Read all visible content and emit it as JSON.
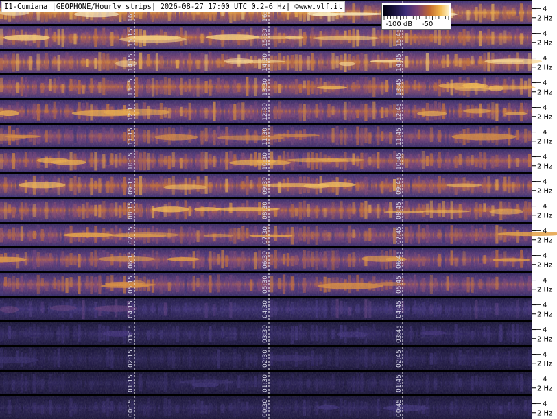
{
  "header": {
    "title": "I1-Cumiana |GEOPHONE/Hourly strips| 2026-08-27 17:00 UTC 0.2-6 Hz| ©www.vlf.it"
  },
  "colorbar": {
    "low_label": "-100 dB",
    "high_label": "-50",
    "stops": [
      "#000010",
      "#1b1442",
      "#3b2d78",
      "#7a3f73",
      "#c2682f",
      "#f2b54a",
      "#fff6d0"
    ]
  },
  "chart_data": {
    "type": "heatmap",
    "title": "I1-Cumiana |GEOPHONE/Hourly strips| 2026-08-27 17:00 UTC 0.2-6 Hz| ©www.vlf.it",
    "colorbar_ticks": [
      "-100 dB",
      "-50"
    ],
    "y_ticks_per_strip": [
      {
        "value": 4,
        "label": "4"
      },
      {
        "value": 2,
        "label": "2 Hz"
      }
    ],
    "strips": [
      {
        "hour": 16,
        "labels": [
          "16:15",
          "16:30",
          ""
        ],
        "intensity": 0.72
      },
      {
        "hour": 15,
        "labels": [
          "15:15",
          "15:30",
          "15:45"
        ],
        "intensity": 0.66
      },
      {
        "hour": 14,
        "labels": [
          "14:15",
          "14:30",
          "14:45"
        ],
        "intensity": 0.68
      },
      {
        "hour": 13,
        "labels": [
          "13:15",
          "13:30",
          "13:45"
        ],
        "intensity": 0.62
      },
      {
        "hour": 12,
        "labels": [
          "12:15",
          "12:30",
          "12:45"
        ],
        "intensity": 0.6
      },
      {
        "hour": 11,
        "labels": [
          "11:15",
          "11:30",
          "11:45"
        ],
        "intensity": 0.55
      },
      {
        "hour": 10,
        "labels": [
          "10:15",
          "10:30",
          "10:45"
        ],
        "intensity": 0.6
      },
      {
        "hour": 9,
        "labels": [
          "09:15",
          "09:30",
          "09:45"
        ],
        "intensity": 0.63
      },
      {
        "hour": 8,
        "labels": [
          "08:15",
          "08:30",
          "08:45"
        ],
        "intensity": 0.62
      },
      {
        "hour": 7,
        "labels": [
          "07:15",
          "07:30",
          "07:45"
        ],
        "intensity": 0.58
      },
      {
        "hour": 6,
        "labels": [
          "06:15",
          "06:30",
          "06:45"
        ],
        "intensity": 0.57
      },
      {
        "hour": 5,
        "labels": [
          "05:15",
          "05:30",
          "05:45"
        ],
        "intensity": 0.55
      },
      {
        "hour": 4,
        "labels": [
          "04:15",
          "04:30",
          "04:45"
        ],
        "intensity": 0.32
      },
      {
        "hour": 3,
        "labels": [
          "03:15",
          "03:30",
          "03:45"
        ],
        "intensity": 0.25
      },
      {
        "hour": 2,
        "labels": [
          "02:15",
          "02:30",
          "02:45"
        ],
        "intensity": 0.22
      },
      {
        "hour": 1,
        "labels": [
          "01:15",
          "01:30",
          "01:45"
        ],
        "intensity": 0.22
      },
      {
        "hour": 0,
        "labels": [
          "00:15",
          "00:30",
          "00:45"
        ],
        "intensity": 0.23
      }
    ]
  }
}
